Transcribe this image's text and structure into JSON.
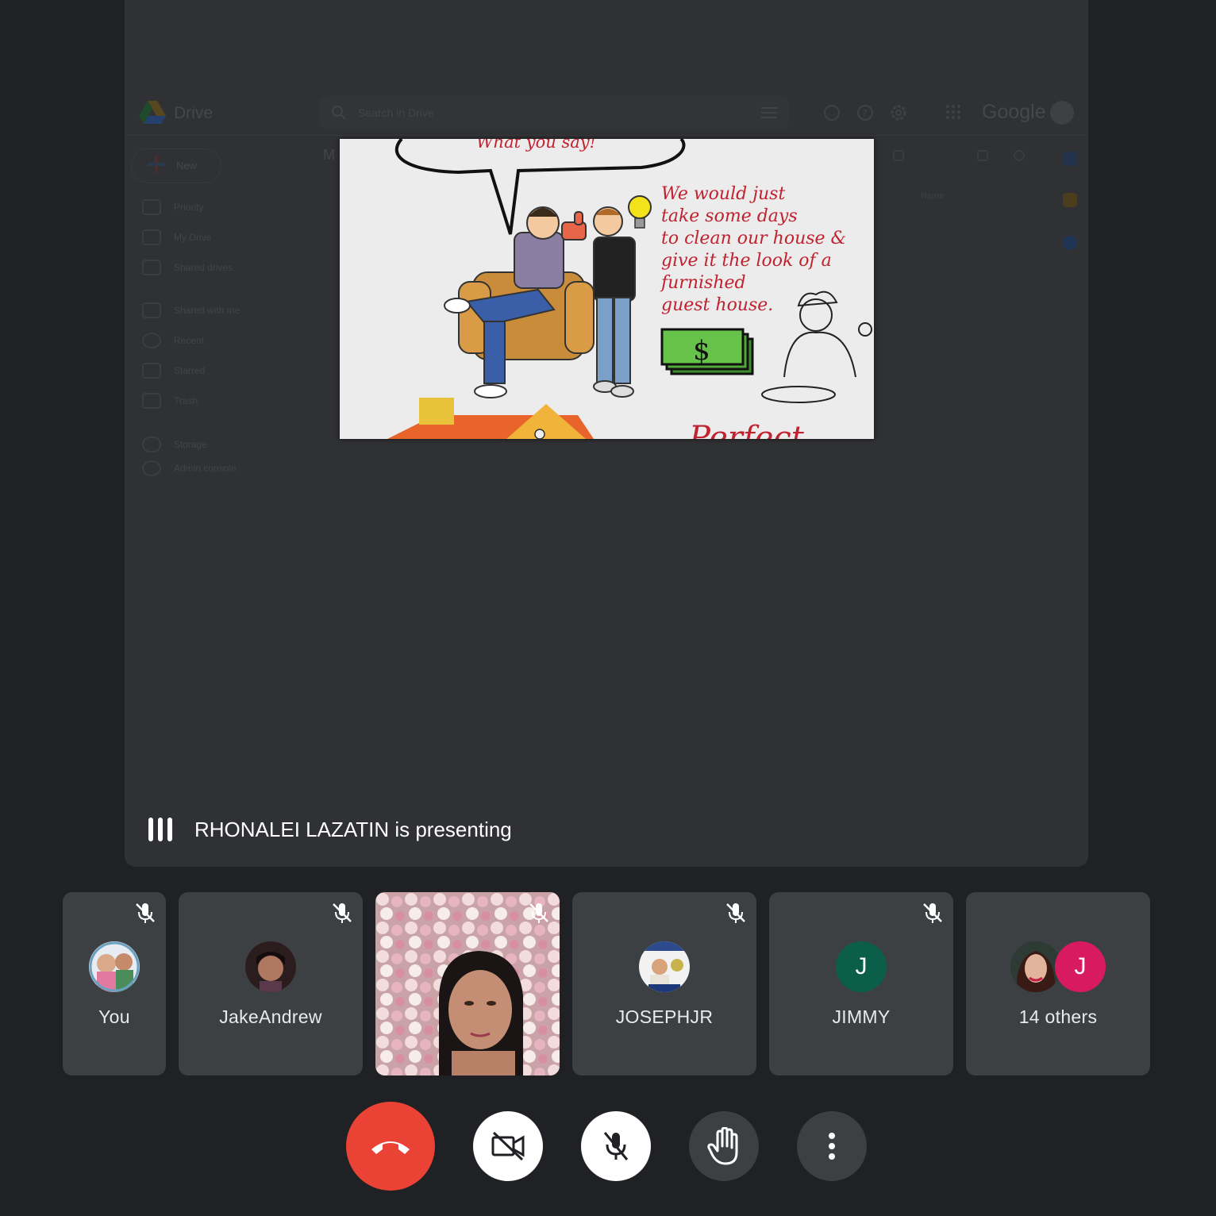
{
  "drive": {
    "app_name": "Drive",
    "search_placeholder": "Search in Drive",
    "google_wordmark": "Google",
    "new_label": "New",
    "nav": [
      {
        "label": "Priority",
        "icon": "check-circle-icon"
      },
      {
        "label": "My Drive",
        "icon": "my-drive-icon"
      },
      {
        "label": "Shared drives",
        "icon": "shared-drives-icon"
      },
      {
        "label": "Shared with me",
        "icon": "people-icon"
      },
      {
        "label": "Recent",
        "icon": "clock-icon"
      },
      {
        "label": "Starred",
        "icon": "star-icon"
      },
      {
        "label": "Trash",
        "icon": "trash-icon"
      },
      {
        "label": "Storage",
        "icon": "cloud-icon"
      },
      {
        "label": "Admin console",
        "icon": "admin-icon"
      }
    ],
    "column_header": "Name",
    "breadcrumb_letter": "M"
  },
  "slide": {
    "top_text": "What you say!",
    "body_text": "We would just\n   take some days\n   to clean our house &\n   give it the look of a\n   furnished\n   guest house.",
    "money_symbol": "$"
  },
  "presenting_banner": "RHONALEI LAZATIN is presenting",
  "participants": [
    {
      "name": "You",
      "muted": true,
      "avatar": "photo"
    },
    {
      "name": "JakeAndrew",
      "muted": true,
      "avatar": "photo"
    },
    {
      "name": "",
      "muted": true,
      "avatar": "video"
    },
    {
      "name": "JOSEPHJR",
      "muted": true,
      "avatar": "photo"
    },
    {
      "name": "JIMMY",
      "muted": true,
      "avatar": "letter",
      "letter": "J",
      "color": "#0b5e4a"
    },
    {
      "name": "14 others",
      "muted": false,
      "avatar": "group",
      "letter": "J",
      "color": "#d81b60"
    }
  ],
  "controls": [
    {
      "name": "end-call",
      "icon": "phone-hangup-icon",
      "color": "#ea4335"
    },
    {
      "name": "camera-off",
      "icon": "video-off-icon",
      "color": "#ffffff"
    },
    {
      "name": "mic-off",
      "icon": "mic-off-icon",
      "color": "#ffffff"
    },
    {
      "name": "raise-hand",
      "icon": "hand-icon",
      "color": "#3c4043"
    },
    {
      "name": "more-options",
      "icon": "more-vert-icon",
      "color": "#3c4043"
    }
  ]
}
